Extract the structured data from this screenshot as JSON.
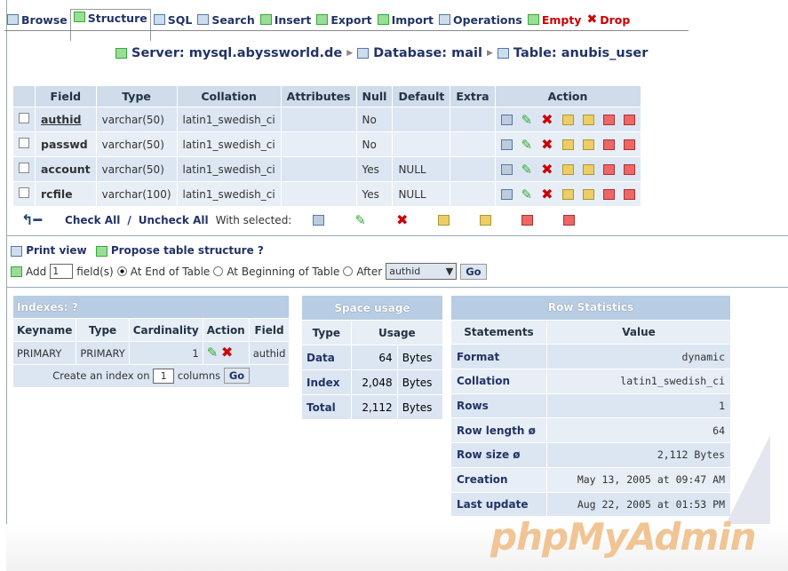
{
  "tabs": [
    {
      "label": "Browse"
    },
    {
      "label": "Structure"
    },
    {
      "label": "SQL"
    },
    {
      "label": "Search"
    },
    {
      "label": "Insert"
    },
    {
      "label": "Export"
    },
    {
      "label": "Import"
    },
    {
      "label": "Operations"
    },
    {
      "label": "Empty"
    },
    {
      "label": "Drop"
    }
  ],
  "breadcrumb": {
    "server": "Server: mysql.abyssworld.de",
    "database": "Database: mail",
    "table": "Table: anubis_user"
  },
  "fields_table": {
    "headers": [
      "Field",
      "Type",
      "Collation",
      "Attributes",
      "Null",
      "Default",
      "Extra",
      "Action"
    ],
    "rows": [
      {
        "field": "authid",
        "type": "varchar(50)",
        "collation": "latin1_swedish_ci",
        "attributes": "",
        "null": "No",
        "default": "",
        "extra": ""
      },
      {
        "field": "passwd",
        "type": "varchar(50)",
        "collation": "latin1_swedish_ci",
        "attributes": "",
        "null": "No",
        "default": "",
        "extra": ""
      },
      {
        "field": "account",
        "type": "varchar(50)",
        "collation": "latin1_swedish_ci",
        "attributes": "",
        "null": "Yes",
        "default": "NULL",
        "extra": ""
      },
      {
        "field": "rcfile",
        "type": "varchar(100)",
        "collation": "latin1_swedish_ci",
        "attributes": "",
        "null": "Yes",
        "default": "NULL",
        "extra": ""
      }
    ]
  },
  "check": {
    "check_all": "Check All",
    "slash": " / ",
    "uncheck_all": "Uncheck All",
    "with_selected": "With selected:"
  },
  "links": {
    "print_view": "Print view",
    "propose": "Propose table structure"
  },
  "add": {
    "label": "Add",
    "value": "1",
    "fields": "field(s)",
    "end": "At End of Table",
    "begin": "At Beginning of Table",
    "after": "After",
    "after_field": "authid",
    "go": "Go"
  },
  "indexes": {
    "title": "Indexes:",
    "headers": [
      "Keyname",
      "Type",
      "Cardinality",
      "Action",
      "Field"
    ],
    "row": {
      "keyname": "PRIMARY",
      "type": "PRIMARY",
      "cardinality": "1",
      "field": "authid"
    },
    "create_label": "Create an index on",
    "create_value": "1",
    "columns": "columns",
    "go": "Go"
  },
  "space": {
    "title": "Space usage",
    "headers": [
      "Type",
      "Usage"
    ],
    "rows": [
      {
        "type": "Data",
        "value": "64",
        "unit": "Bytes"
      },
      {
        "type": "Index",
        "value": "2,048",
        "unit": "Bytes"
      },
      {
        "type": "Total",
        "value": "2,112",
        "unit": "Bytes"
      }
    ]
  },
  "stats": {
    "title": "Row Statistics",
    "headers": [
      "Statements",
      "Value"
    ],
    "rows": [
      {
        "k": "Format",
        "v": "dynamic"
      },
      {
        "k": "Collation",
        "v": "latin1_swedish_ci"
      },
      {
        "k": "Rows",
        "v": "1"
      },
      {
        "k": "Row length ø",
        "v": "64"
      },
      {
        "k": "Row size ø",
        "v": "2,112 Bytes"
      },
      {
        "k": "Creation",
        "v": "May 13, 2005 at 09:47 AM"
      },
      {
        "k": "Last update",
        "v": "Aug 22, 2005 at 01:53 PM"
      }
    ]
  },
  "logo": {
    "php": "php",
    "myadmin": "MyAdmin"
  }
}
